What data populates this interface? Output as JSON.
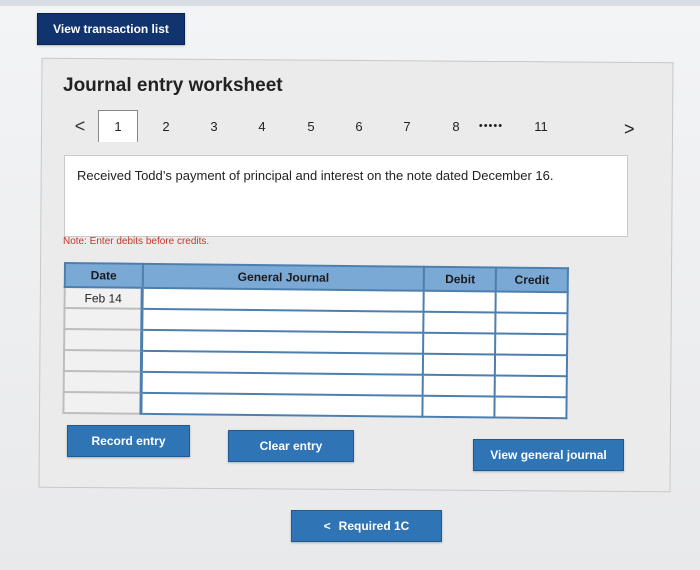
{
  "header": {
    "view_transaction_list": "View transaction list"
  },
  "worksheet": {
    "title": "Journal entry worksheet",
    "tabs": [
      "1",
      "2",
      "3",
      "4",
      "5",
      "6",
      "7",
      "8",
      "11"
    ],
    "ellipsis": "•••••",
    "active_tab": "1",
    "prev_arrow": "<",
    "next_arrow": ">",
    "description": "Received Todd’s payment of principal and interest on the note dated December 16.",
    "note": "Note: Enter debits before credits."
  },
  "journal": {
    "columns": {
      "date": "Date",
      "general_journal": "General Journal",
      "debit": "Debit",
      "credit": "Credit"
    },
    "rows": [
      {
        "date": "Feb 14",
        "account": "",
        "debit": "",
        "credit": ""
      },
      {
        "date": "",
        "account": "",
        "debit": "",
        "credit": ""
      },
      {
        "date": "",
        "account": "",
        "debit": "",
        "credit": ""
      },
      {
        "date": "",
        "account": "",
        "debit": "",
        "credit": ""
      },
      {
        "date": "",
        "account": "",
        "debit": "",
        "credit": ""
      },
      {
        "date": "",
        "account": "",
        "debit": "",
        "credit": ""
      }
    ]
  },
  "actions": {
    "record_entry": "Record entry",
    "clear_entry": "Clear entry",
    "view_general_journal": "View general journal"
  },
  "footer": {
    "back_arrow": "<",
    "required_label": "Required 1C"
  },
  "colors": {
    "button_blue": "#2f74b5",
    "button_navy": "#12346e",
    "table_header": "#7ba9d6",
    "note_red": "#c0392b"
  },
  "icons": {
    "prev": "chevron-left-icon",
    "next": "chevron-right-icon"
  }
}
